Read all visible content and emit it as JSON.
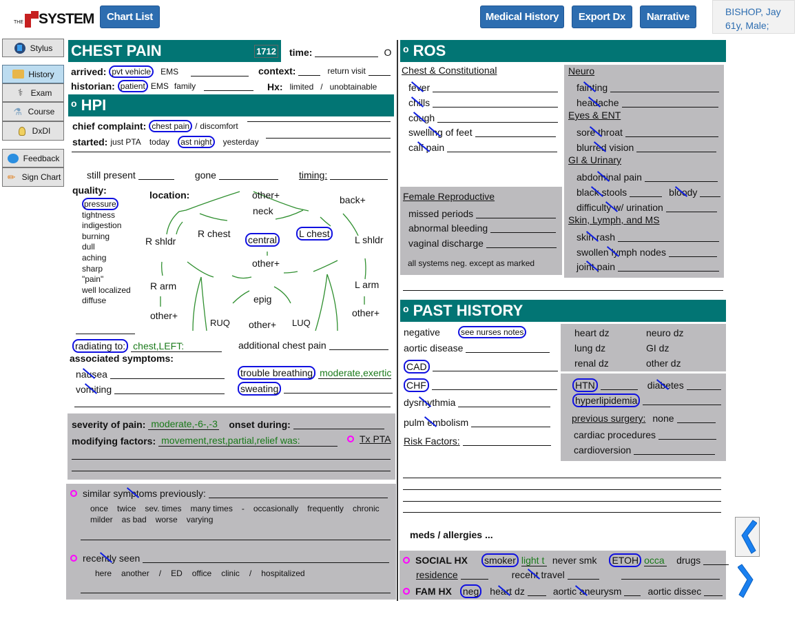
{
  "header": {
    "logo_prefix": "THE",
    "logo_text": "SYSTEM",
    "chart_list": "Chart List",
    "medical_history": "Medical History",
    "export_dx": "Export Dx",
    "narrative": "Narrative",
    "patient_name": "BISHOP, Jay",
    "patient_info": "61y, Male;"
  },
  "sidebar": {
    "stylus": "Stylus",
    "items": [
      {
        "label": "History",
        "icon": "folder-user-icon",
        "active": true
      },
      {
        "label": "Exam",
        "icon": "stethoscope-icon"
      },
      {
        "label": "Course",
        "icon": "flask-icon"
      },
      {
        "label": "DxDI",
        "icon": "lightbulb-icon"
      }
    ],
    "feedback": "Feedback",
    "sign_chart": "Sign Chart"
  },
  "chest_pain": {
    "title": "CHEST PAIN",
    "code": "1712",
    "time_label": "time:",
    "time_marker": "O",
    "arrived_label": "arrived:",
    "arrived_opts": [
      "pvt vehicle",
      "EMS"
    ],
    "arrived_selected": "pvt vehicle",
    "context_label": "context:",
    "context_opt": "return visit",
    "historian_label": "historian:",
    "historian_opts": [
      "patient",
      "EMS",
      "family"
    ],
    "historian_selected": "patient",
    "hx_label": "Hx:",
    "hx_opts": [
      "limited",
      "/",
      "unobtainable"
    ]
  },
  "hpi": {
    "title": "HPI",
    "chief_label": "chief complaint:",
    "chief_opts": [
      "chest pain",
      "/",
      "discomfort"
    ],
    "chief_selected": "chest pain",
    "started_label": "started:",
    "started_opts": [
      "just PTA",
      "today",
      "ast night",
      "yesterday"
    ],
    "started_selected": "ast night",
    "still_present": "still present",
    "gone": "gone",
    "timing": "timing:",
    "quality_label": "quality:",
    "quality_opts": [
      "pressure",
      "tightness",
      "indigestion",
      "burning",
      "dull",
      "aching",
      "sharp",
      "\"pain\"",
      "well localized",
      "diffuse"
    ],
    "quality_selected": "pressure",
    "location_label": "location:",
    "location": {
      "other_top": "other+",
      "neck": "neck",
      "back": "back+",
      "r_shldr": "R shldr",
      "r_chest": "R chest",
      "central": "central",
      "l_chest": "L chest",
      "l_shldr": "L shldr",
      "other_mid": "other+",
      "r_arm": "R arm",
      "epig": "epig",
      "l_arm": "L arm",
      "other_l": "other+",
      "ruq": "RUQ",
      "other_bot": "other+",
      "luq": "LUQ",
      "other_r": "other+"
    },
    "location_selected": [
      "central",
      "L chest"
    ],
    "radiating_label": "radiating to:",
    "radiating_value": "chest,LEFT:",
    "additional": "additional chest pain",
    "assoc_label": "associated symptoms:",
    "nausea": "nausea",
    "vomiting": "vomiting",
    "trouble_breathing": "trouble breathing",
    "trouble_value": "moderate,exertic",
    "sweating": "sweating",
    "severity_label": "severity of pain:",
    "severity_value": "moderate,-6-,-3",
    "onset_label": "onset during:",
    "modifying_label": "modifying factors:",
    "modifying_value": "movement,rest,partial,relief was:",
    "tx_pta": "Tx PTA",
    "similar_label": "similar symptoms previously:",
    "similar_opts1": [
      "once",
      "twice",
      "sev. times",
      "many times",
      "-",
      "occasionally",
      "frequently",
      "chronic"
    ],
    "similar_opts2": [
      "milder",
      "as bad",
      "worse",
      "varying"
    ],
    "recently_label": "recently seen",
    "recently_opts": [
      "here",
      "another",
      "/",
      "ED",
      "office",
      "clinic",
      "/",
      "hospitalized"
    ]
  },
  "ros": {
    "title": "ROS",
    "chest_header": "Chest & Constitutional",
    "chest_items": [
      "fever",
      "chills",
      "cough",
      "swelling of feet",
      "calf pain"
    ],
    "female_header": "Female Reproductive",
    "female_items": [
      "missed periods",
      "abnormal bleeding",
      "vaginal discharge"
    ],
    "all_neg": "all systems neg. except as marked",
    "neuro_header": "Neuro",
    "neuro_items": [
      "fainting",
      "headache"
    ],
    "eyes_header": "Eyes & ENT",
    "eyes_items": [
      "sore throat",
      "blurred vision"
    ],
    "gi_header": "GI & Urinary",
    "gi_items": [
      "abdominal pain",
      "black stools",
      "bloody",
      "difficulty w/ urination"
    ],
    "skin_header": "Skin, Lymph, and MS",
    "skin_items": [
      "skin rash",
      "swollen lymph nodes",
      "joint pain"
    ]
  },
  "past_history": {
    "title": "PAST HISTORY",
    "negative": "negative",
    "see_nurses": "see nurses notes",
    "aortic": "aortic disease",
    "cad": "CAD",
    "chf": "CHF",
    "dysrhythmia": "dysrhythmia",
    "pulm": "pulm embolism",
    "risk": "Risk Factors:",
    "grid": [
      "heart dz",
      "neuro dz",
      "lung dz",
      "GI dz",
      "renal dz",
      "other dz"
    ],
    "htn": "HTN",
    "diabetes": "diabetes",
    "hyperlipidemia": "hyperlipidemia",
    "prev_surgery": "previous surgery:",
    "none": "none",
    "cardiac_proc": "cardiac procedures",
    "cardioversion": "cardioversion",
    "meds": "meds / allergies ..."
  },
  "social": {
    "social_label": "SOCIAL HX",
    "smoker": "smoker",
    "smoker_value": "light t",
    "never_smk": "never smk",
    "etoh": "ETOH",
    "etoh_value": "occa",
    "drugs": "drugs",
    "residence": "residence",
    "recent_travel": "recent travel",
    "fam_label": "FAM HX",
    "neg": "neg",
    "heart_dz": "heart dz",
    "aortic_aneurysm": "aortic aneurysm",
    "aortic_dissec": "aortic dissec"
  },
  "colors": {
    "teal": "#027574",
    "circle": "#1010e0",
    "green_text": "#1a7a1a",
    "gray_panel": "#bcbbbe",
    "magenta": "#ff00ff",
    "button_blue": "#2d6db0"
  }
}
